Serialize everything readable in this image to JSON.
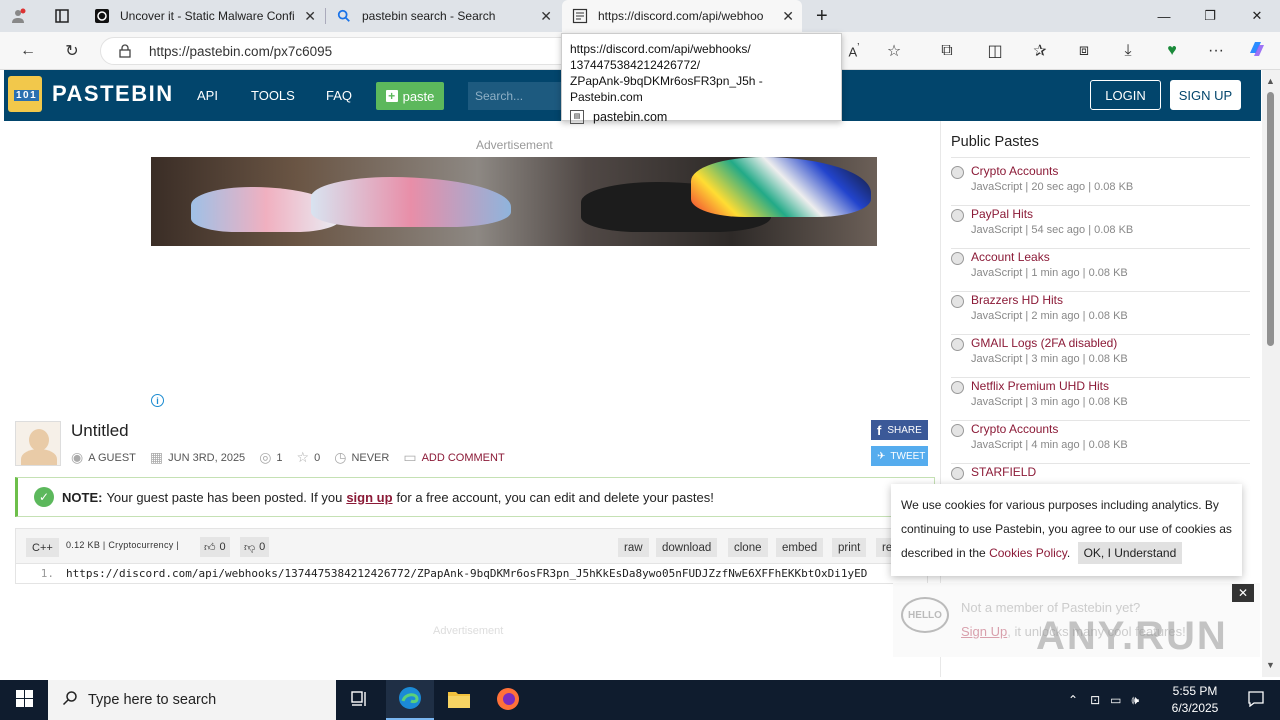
{
  "browser": {
    "tabs": [
      {
        "title": "Uncover it - Static Malware Confi",
        "icon": "uncoverit-icon"
      },
      {
        "title": "pastebin search - Search",
        "icon": "search-icon"
      },
      {
        "title": "https://discord.com/api/webhoo",
        "icon": "page-icon"
      }
    ],
    "url": "https://pastebin.com/px7c6095",
    "tooltip": {
      "line1": "https://discord.com/api/webhooks/",
      "line2": "1374475384212426772/",
      "line3": "ZPapAnk-9bqDKMr6osFR3pn_J5h - Pastebin.com",
      "site": "pastebin.com"
    }
  },
  "header": {
    "logo": "PASTEBIN",
    "nav": [
      "API",
      "TOOLS",
      "FAQ"
    ],
    "paste_button": "paste",
    "search_placeholder": "Search...",
    "login": "LOGIN",
    "signup": "SIGN UP"
  },
  "ad": {
    "label": "Advertisement",
    "label2": "Advertisement"
  },
  "paste": {
    "title": "Untitled",
    "author": "A GUEST",
    "date": "JUN 3RD, 2025",
    "views": "1",
    "stars": "0",
    "expiry": "NEVER",
    "add_comment": "ADD COMMENT",
    "share": "SHARE",
    "tweet": "TWEET",
    "language": "C++",
    "size_category": "0.12 KB | Cryptocurrency |",
    "likes": "0",
    "dislikes": "0",
    "buttons": [
      "raw",
      "download",
      "clone",
      "embed",
      "print",
      "re"
    ],
    "line_number": "1.",
    "code": "https://discord.com/api/webhooks/1374475384212426772/ZPapAnk-9bqDKMr6osFR3pn_J5hKkEsDa8ywo05nFUDJZzfNwE6XFFhEKKbtOxDi1yED"
  },
  "notice": {
    "label": "NOTE:",
    "text_before": "Your guest paste has been posted. If you",
    "link": "sign up",
    "text_after": "for a free account, you can edit and delete your pastes!"
  },
  "sidebar": {
    "title": "Public Pastes",
    "items": [
      {
        "name": "Crypto Accounts",
        "sub": "JavaScript | 20 sec ago | 0.08 KB"
      },
      {
        "name": "PayPal Hits",
        "sub": "JavaScript | 54 sec ago | 0.08 KB"
      },
      {
        "name": "Account Leaks",
        "sub": "JavaScript | 1 min ago | 0.08 KB"
      },
      {
        "name": "Brazzers HD Hits",
        "sub": "JavaScript | 2 min ago | 0.08 KB"
      },
      {
        "name": "GMAIL Logs (2FA disabled)",
        "sub": "JavaScript | 3 min ago | 0.08 KB"
      },
      {
        "name": "Netflix Premium UHD Hits",
        "sub": "JavaScript | 3 min ago | 0.08 KB"
      },
      {
        "name": "Crypto Accounts",
        "sub": "JavaScript | 4 min ago | 0.08 KB"
      },
      {
        "name": "STARFIELD",
        "sub": ""
      }
    ]
  },
  "cookie": {
    "text": "We use cookies for various purposes including analytics. By continuing to use Pastebin, you agree to our use of cookies as described in the",
    "link": "Cookies Policy",
    "ok": "OK, I Understand"
  },
  "member_box": {
    "hello": "HELLO",
    "question": "Not a member of Pastebin yet?",
    "signup": "Sign Up",
    "rest": ", it unlocks many cool features!"
  },
  "watermark": "ANY.RUN",
  "taskbar": {
    "search_placeholder": "Type here to search",
    "time": "5:55 PM",
    "date": "6/3/2025"
  },
  "colors": {
    "header_bg": "#02456c",
    "accent": "#8b1a37",
    "paste_green": "#5cb85c"
  }
}
